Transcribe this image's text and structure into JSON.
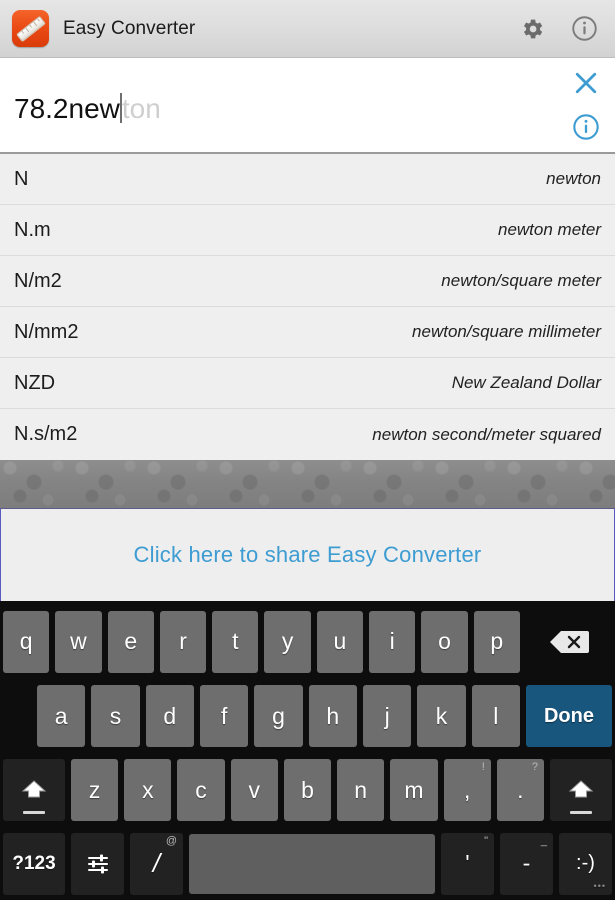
{
  "header": {
    "title": "Easy Converter",
    "app_icon": "ruler-app-icon",
    "settings_icon": "gear-icon",
    "info_icon": "info-circle-icon"
  },
  "search": {
    "typed": "78.2new",
    "autocomplete_suffix": "ton",
    "full_value": "78.2newton",
    "clear_icon": "close-x-icon",
    "info_icon": "info-circle-icon",
    "accent_color": "#3d9cd2"
  },
  "suggestions": [
    {
      "code": "N",
      "name": "newton"
    },
    {
      "code": "N.m",
      "name": "newton meter"
    },
    {
      "code": "N/m2",
      "name": "newton/square meter"
    },
    {
      "code": "N/mm2",
      "name": "newton/square millimeter"
    },
    {
      "code": "NZD",
      "name": "New Zealand Dollar"
    },
    {
      "code": "N.s/m2",
      "name": "newton second/meter squared"
    }
  ],
  "share_banner": {
    "label": "Click here to share Easy Converter",
    "text_color": "#3d9cd2",
    "border_color": "#5a5ac0"
  },
  "keyboard": {
    "row1": [
      "q",
      "w",
      "e",
      "r",
      "t",
      "y",
      "u",
      "i",
      "o",
      "p"
    ],
    "backspace_icon": "backspace-icon",
    "row2": [
      "a",
      "s",
      "d",
      "f",
      "g",
      "h",
      "j",
      "k",
      "l"
    ],
    "done_label": "Done",
    "row3": [
      "z",
      "x",
      "c",
      "v",
      "b",
      "n",
      "m"
    ],
    "shift_icon": "shift-arrow-icon",
    "comma_key": {
      "label": ",",
      "sup": "!"
    },
    "period_key": {
      "label": ".",
      "sup": "?"
    },
    "row4": {
      "numeric_label": "?123",
      "settings_icon": "keyboard-settings-icon",
      "slash_key": {
        "label": "/",
        "sup": "@"
      },
      "space_label": "",
      "apostrophe_key": {
        "label": "'",
        "sup": "\""
      },
      "dash_key": {
        "label": "-",
        "sup": "_"
      },
      "emoji_key": {
        "label": ":-)",
        "dots": "•••"
      }
    }
  }
}
